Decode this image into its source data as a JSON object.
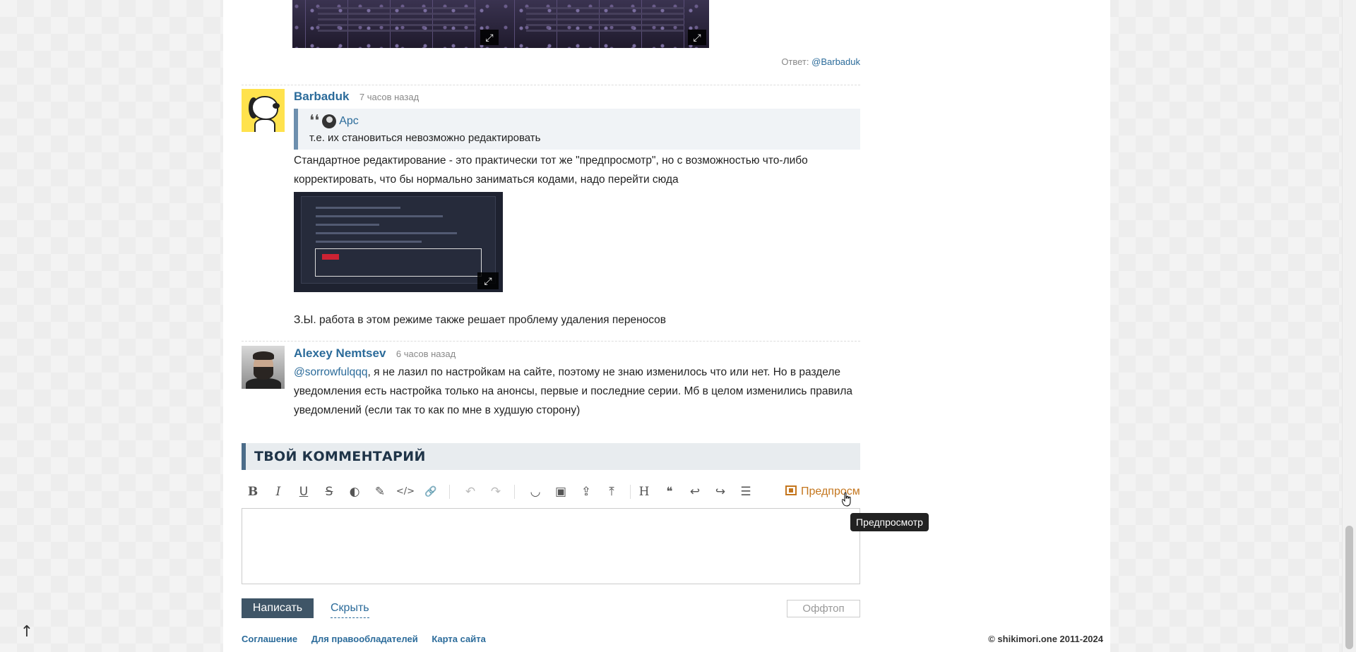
{
  "previous_comment": {
    "reply_label": "Ответ:",
    "reply_user": "@Barbaduk",
    "expand_icon": "⤢"
  },
  "comments": [
    {
      "author": "Barbaduk",
      "time": "7 часов назад",
      "quote": {
        "user": "Арс",
        "text": "т.е. их становиться невозможно редактировать"
      },
      "text": "Стандартное редактирование - это практически тот же \"предпросмотр\", но с возможностью что-либо корректировать, что бы нормально заниматься кодами, надо перейти сюда",
      "footer_text": "З.Ы. работа в этом режиме также решает проблему удаления переносов"
    },
    {
      "author": "Alexey Nemtsev",
      "time": "6 часов назад",
      "mention": "@sorrowfulqqq",
      "text": ", я не лазил по настройкам на сайте, поэтому не знаю изменилось что или нет. Но в разделе уведомления есть настройка только на анонсы, первые и последние серии. Мб в целом изменились правила уведомлений (если так то как по мне в худшую сторону)"
    }
  ],
  "editor": {
    "title": "ТВОЙ КОММЕНТАРИЙ",
    "toolbar": {
      "bold": "B",
      "italic": "I",
      "underline": "U",
      "strike": "S",
      "spoiler": "◐",
      "color": "✎",
      "code": "</>",
      "link": "🔗",
      "undo": "↶",
      "redo": "↷",
      "smiley": "◡",
      "image": "▣",
      "upload": "⇪",
      "upload_file": "⤒",
      "heading": "H",
      "quote": "❝",
      "reply": "↩",
      "reply_alt": "↪",
      "list": "☰",
      "preview_label": "Предпросмотр"
    },
    "tooltip": "Предпросмотр",
    "textarea_value": "",
    "submit_label": "Написать",
    "hide_label": "Скрыть",
    "offtopic_label": "Оффтоп"
  },
  "footer": {
    "links": [
      "Соглашение",
      "Для правообладателей",
      "Карта сайта"
    ],
    "copyright": "© shikimori.one 2011-2024"
  },
  "to_top_icon": "↑"
}
